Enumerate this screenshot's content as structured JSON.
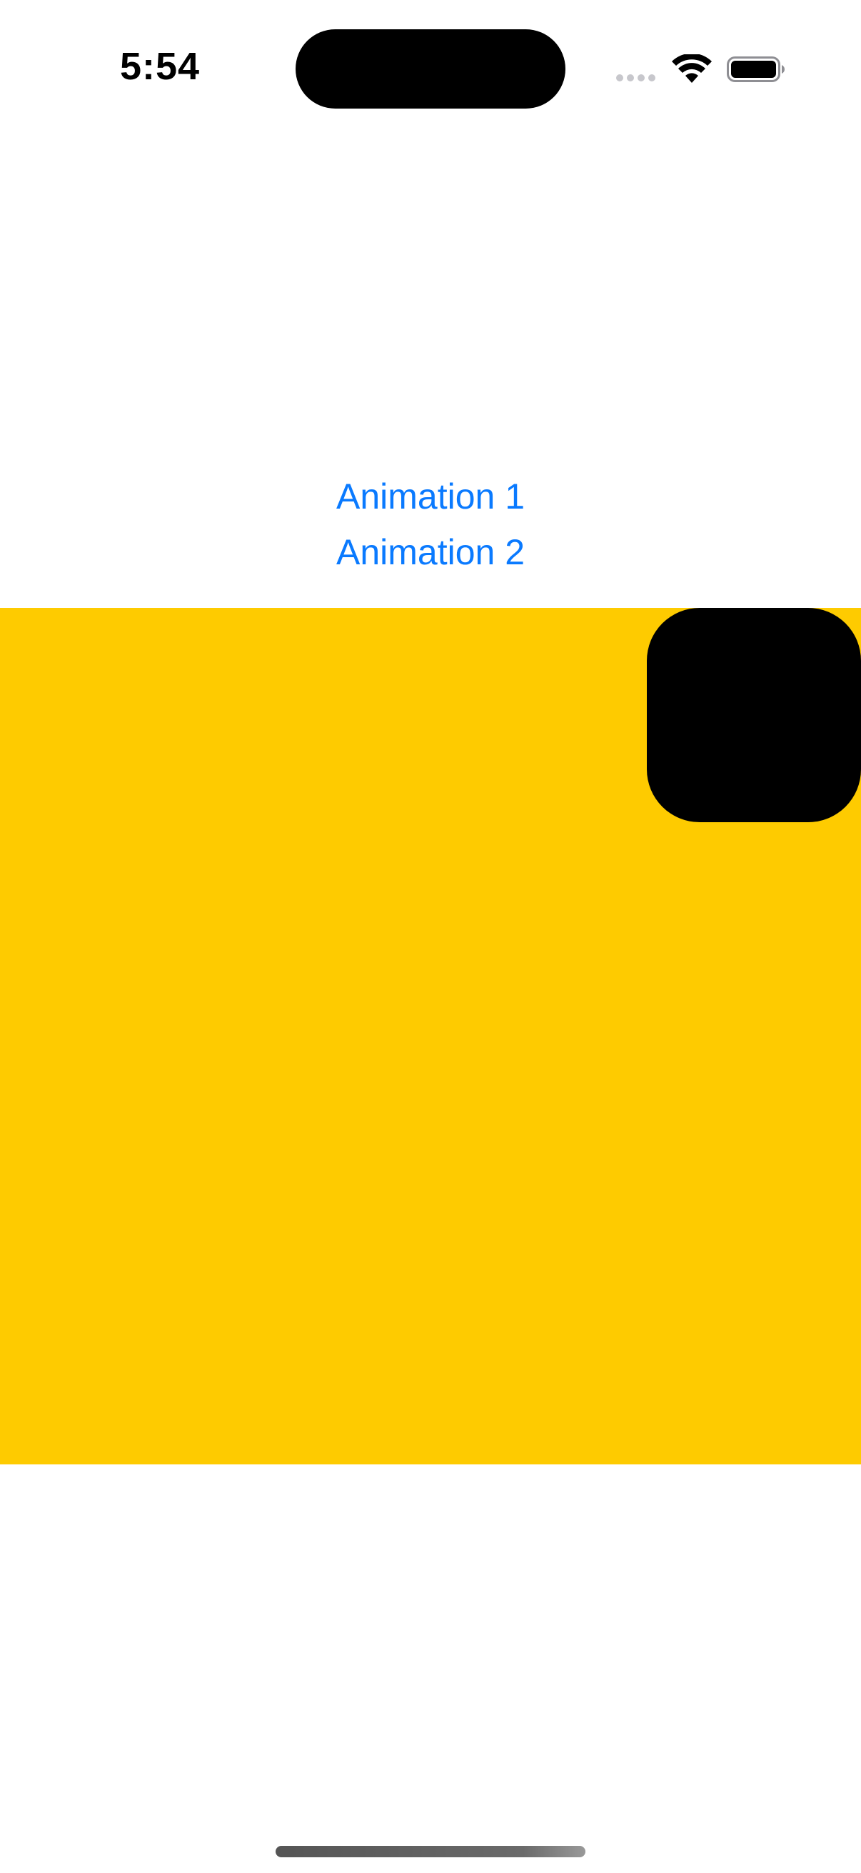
{
  "status_bar": {
    "time": "5:54",
    "icons": [
      "cellular-signal-icon",
      "wifi-icon",
      "battery-icon"
    ]
  },
  "main": {
    "animation_1_label": "Animation 1",
    "animation_2_label": "Animation 2",
    "canvas_color": "#fecb00",
    "shape_color": "#000000",
    "button_color": "#0a7aff"
  }
}
